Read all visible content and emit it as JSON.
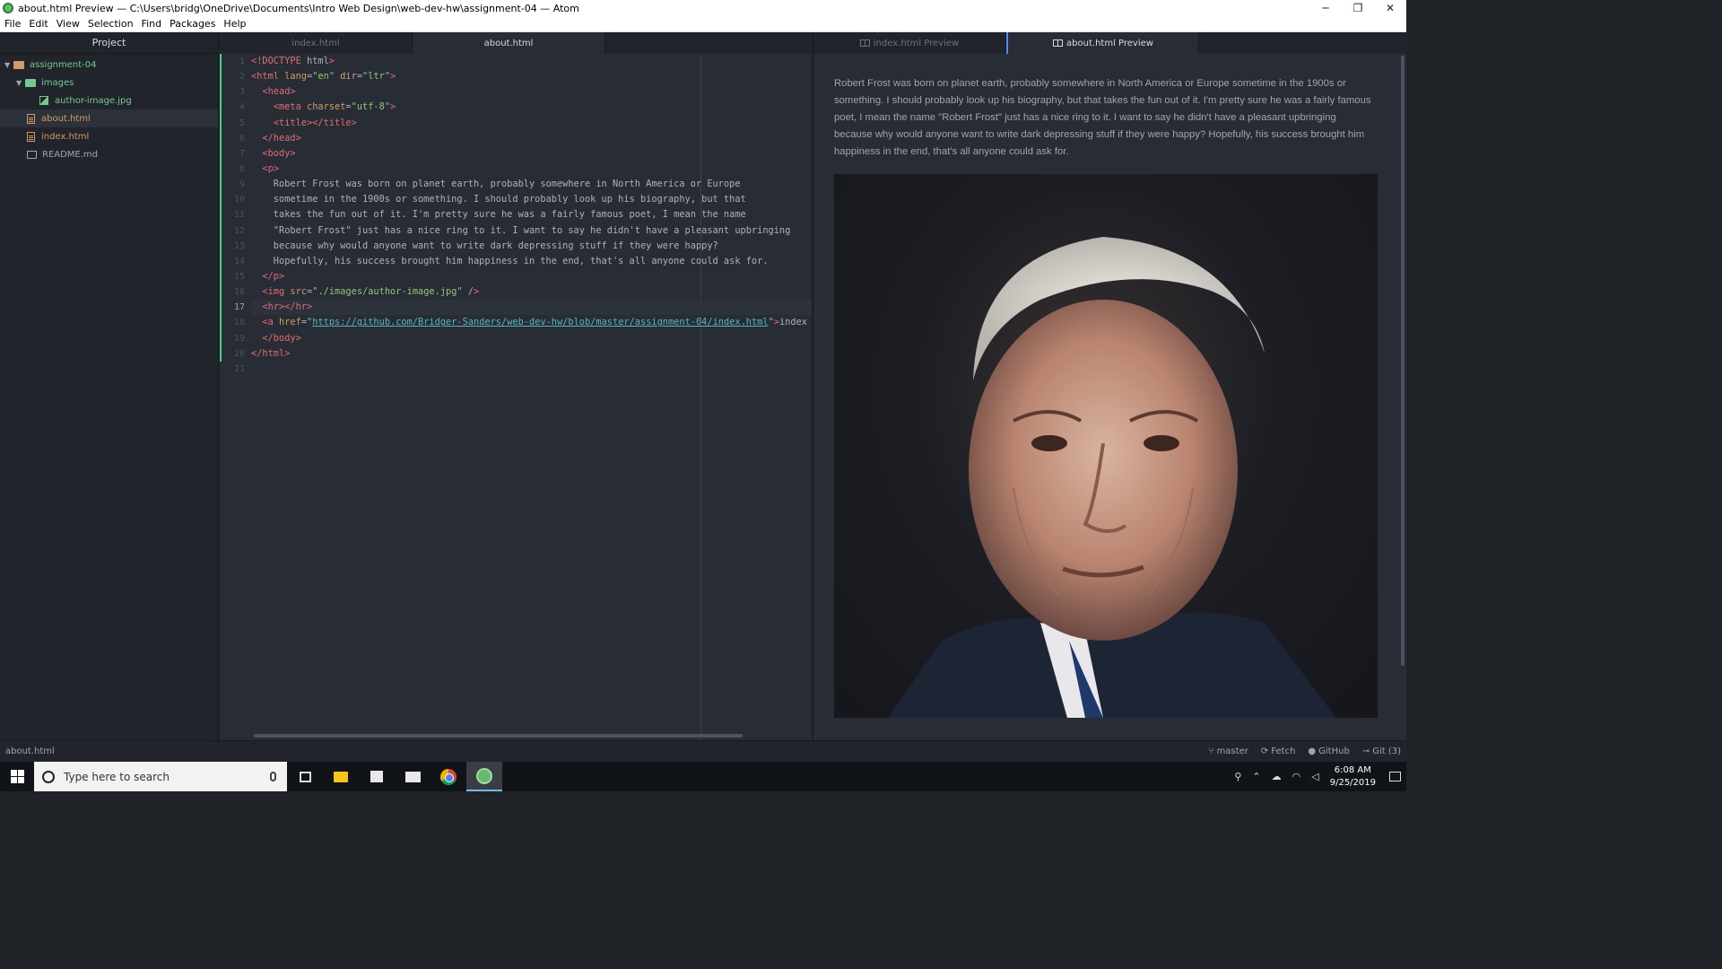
{
  "window": {
    "title": "about.html Preview — C:\\Users\\bridg\\OneDrive\\Documents\\Intro Web Design\\web-dev-hw\\assignment-04 — Atom",
    "minimize": "─",
    "maximize": "❐",
    "close": "✕"
  },
  "menu": [
    "File",
    "Edit",
    "View",
    "Selection",
    "Find",
    "Packages",
    "Help"
  ],
  "tree": {
    "header": "Project",
    "root": "assignment-04",
    "images_folder": "images",
    "image_file": "author-image.jpg",
    "files": [
      "about.html",
      "index.html",
      "README.md"
    ]
  },
  "editor_tabs": [
    "index.html",
    "about.html"
  ],
  "preview_tabs": [
    "index.html Preview",
    "about.html Preview"
  ],
  "code_lines": [
    "<!DOCTYPE html>",
    "<html lang=\"en\" dir=\"ltr\">",
    "  <head>",
    "    <meta charset=\"utf-8\">",
    "    <title></title>",
    "  </head>",
    "  <body>",
    "  <p>",
    "    Robert Frost was born on planet earth, probably somewhere in North America or Europe",
    "    sometime in the 1900s or something. I should probably look up his biography, but that",
    "    takes the fun out of it. I'm pretty sure he was a fairly famous poet, I mean the name",
    "    \"Robert Frost\" just has a nice ring to it. I want to say he didn't have a pleasant upbringing",
    "    because why would anyone want to write dark depressing stuff if they were happy?",
    "    Hopefully, his success brought him happiness in the end, that's all anyone could ask for.",
    "  </p>",
    "  <img src=\"./images/author-image.jpg\" />",
    "  <hr></hr>",
    "  <a href=\"https://github.com/Bridger-Sanders/web-dev-hw/blob/master/assignment-04/index.html\">index",
    "  </body>",
    "</html>",
    ""
  ],
  "cursor_line": 17,
  "preview_paragraph": "Robert Frost was born on planet earth, probably somewhere in North America or Europe sometime in the 1900s or something. I should probably look up his biography, but that takes the fun out of it. I'm pretty sure he was a fairly famous poet, I mean the name \"Robert Frost\" just has a nice ring to it. I want to say he didn't have a pleasant upbringing because why would anyone want to write dark depressing stuff if they were happy? Hopefully, his success brought him happiness in the end, that's all anyone could ask for.",
  "status": {
    "file": "about.html",
    "branch": "master",
    "fetch": "Fetch",
    "github": "GitHub",
    "git": "Git (3)"
  },
  "taskbar": {
    "search_placeholder": "Type here to search",
    "time": "6:08 AM",
    "date": "9/25/2019"
  },
  "colors": {
    "accent": "#528bff",
    "added": "#43d08a",
    "untracked": "#73c990"
  }
}
